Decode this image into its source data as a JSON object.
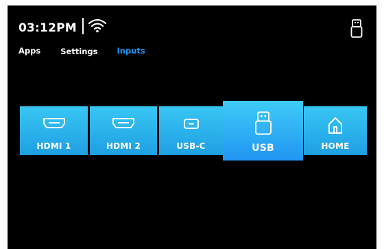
{
  "status": {
    "time": "03:12PM",
    "wifi_icon": "wifi-icon",
    "usb_icon": "usb-drive-icon"
  },
  "nav": {
    "tabs": [
      {
        "label": "Apps",
        "active": false
      },
      {
        "label": "Settings",
        "active": false
      },
      {
        "label": "Inputs",
        "active": true
      }
    ]
  },
  "inputs": {
    "selected": "USB",
    "items": [
      {
        "label": "HDMI 1",
        "icon": "hdmi-port-icon"
      },
      {
        "label": "HDMI 2",
        "icon": "hdmi-port-icon"
      },
      {
        "label": "USB-C",
        "icon": "usb-c-port-icon"
      },
      {
        "label": "USB",
        "icon": "usb-drive-icon"
      },
      {
        "label": "HOME",
        "icon": "home-icon"
      }
    ]
  },
  "colors": {
    "background": "#000000",
    "active_tab": "#2196f3",
    "tile_gradient_top": "#38c6f4",
    "tile_gradient_bottom": "#1f9fe3",
    "text": "#ffffff"
  }
}
